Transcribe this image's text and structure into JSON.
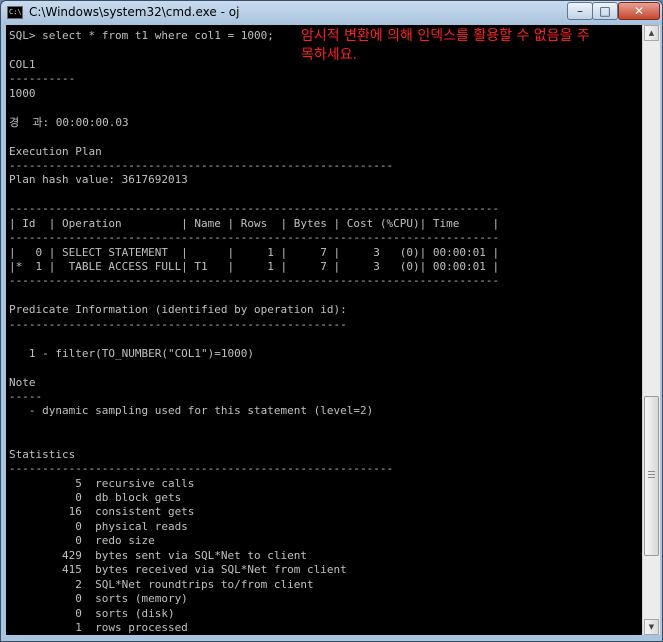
{
  "window": {
    "title": "C:\\Windows\\system32\\cmd.exe - oj",
    "icon_label": "C:\\",
    "minimize_glyph": "–",
    "maximize_glyph": "□",
    "close_glyph": "✕"
  },
  "annotation": "암시적 변환에 의해 인덱스를 활용할 수 없음을 주목하세요.",
  "console_lines": [
    "SQL> select * from t1 where col1 = 1000;",
    "",
    "COL1",
    "----------",
    "1000",
    "",
    "경  과: 00:00:00.03",
    "",
    "Execution Plan",
    "----------------------------------------------------------",
    "Plan hash value: 3617692013",
    "",
    "--------------------------------------------------------------------------",
    "| Id  | Operation         | Name | Rows  | Bytes | Cost (%CPU)| Time     |",
    "--------------------------------------------------------------------------",
    "|   0 | SELECT STATEMENT  |      |     1 |     7 |     3   (0)| 00:00:01 |",
    "|*  1 |  TABLE ACCESS FULL| T1   |     1 |     7 |     3   (0)| 00:00:01 |",
    "--------------------------------------------------------------------------",
    "",
    "Predicate Information (identified by operation id):",
    "---------------------------------------------------",
    "",
    "   1 - filter(TO_NUMBER(\"COL1\")=1000)",
    "",
    "Note",
    "-----",
    "   - dynamic sampling used for this statement (level=2)",
    "",
    "",
    "Statistics",
    "----------------------------------------------------------",
    "          5  recursive calls",
    "          0  db block gets",
    "         16  consistent gets",
    "          0  physical reads",
    "          0  redo size",
    "        429  bytes sent via SQL*Net to client",
    "        415  bytes received via SQL*Net from client",
    "          2  SQL*Net roundtrips to/from client",
    "          0  sorts (memory)",
    "          0  sorts (disk)",
    "          1  rows processed"
  ],
  "scrollbar": {
    "up_glyph": "▲",
    "down_glyph": "▼",
    "position_fraction": 0.85
  }
}
